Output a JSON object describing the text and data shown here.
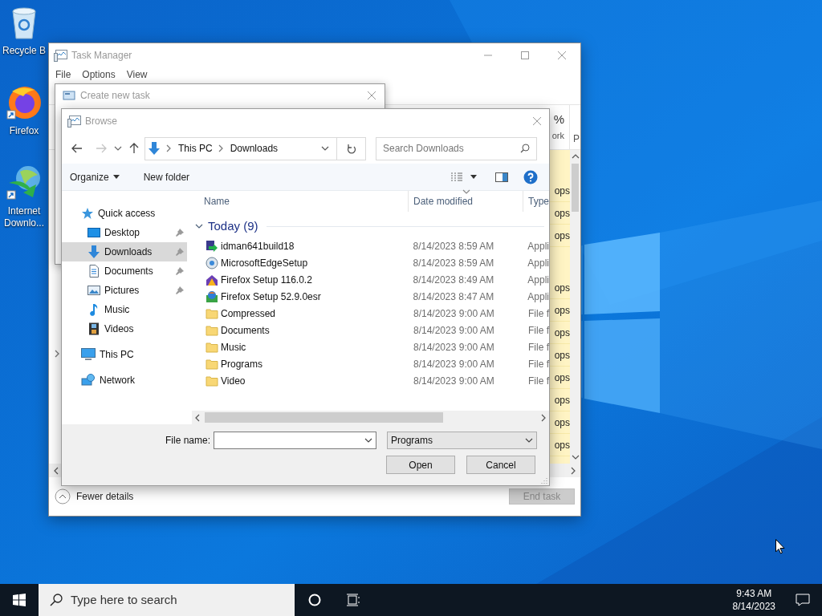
{
  "desktop_icons": [
    {
      "kind": "recycle",
      "label": "Recycle B"
    },
    {
      "kind": "firefox",
      "label": "Firefox"
    },
    {
      "kind": "idm",
      "label": "Internet Downlo..."
    }
  ],
  "task_manager": {
    "title": "Task Manager",
    "menu": [
      "File",
      "Options",
      "View"
    ],
    "column_header_top": "%",
    "column_header": "ork",
    "next_column_header": "P",
    "rows": [
      {
        "kind": "group"
      },
      {
        "kind": "process",
        "text": "ops"
      },
      {
        "kind": "process",
        "text": "ops"
      },
      {
        "kind": "process",
        "text": "ops"
      },
      {
        "kind": "group"
      },
      {
        "kind": "process",
        "text": "ops"
      },
      {
        "kind": "process",
        "text": "ops"
      },
      {
        "kind": "process",
        "text": "ops"
      },
      {
        "kind": "process",
        "text": "ops"
      },
      {
        "kind": "process",
        "text": "ops"
      },
      {
        "kind": "process",
        "text": "ops"
      },
      {
        "kind": "process",
        "text": "ops"
      },
      {
        "kind": "process",
        "text": "ops"
      }
    ],
    "fewer_details": "Fewer details",
    "end_task": {
      "label": "End task",
      "disabled": true
    }
  },
  "create_task": {
    "title": "Create new task"
  },
  "browse": {
    "title": "Browse",
    "path": [
      "This PC",
      "Downloads"
    ],
    "search_placeholder": "Search Downloads",
    "organize": "Organize",
    "new_folder": "New folder",
    "nav": [
      {
        "kind": "quick-access",
        "label": "Quick access",
        "selected": false,
        "children": [
          {
            "kind": "desktop",
            "label": "Desktop",
            "pinned": true,
            "selected": false
          },
          {
            "kind": "downloads",
            "label": "Downloads",
            "pinned": true,
            "selected": true
          },
          {
            "kind": "documents",
            "label": "Documents",
            "pinned": true,
            "selected": false
          },
          {
            "kind": "pictures",
            "label": "Pictures",
            "pinned": true,
            "selected": false
          },
          {
            "kind": "music",
            "label": "Music",
            "pinned": false,
            "selected": false
          },
          {
            "kind": "videos",
            "label": "Videos",
            "pinned": false,
            "selected": false
          }
        ]
      },
      {
        "kind": "this-pc",
        "label": "This PC",
        "selected": false
      },
      {
        "kind": "network",
        "label": "Network",
        "selected": false
      }
    ],
    "columns": [
      "Name",
      "Date modified",
      "Type"
    ],
    "group": {
      "label": "Today (9)",
      "expanded": true
    },
    "files": [
      {
        "kind": "idm",
        "name": "idman641build18",
        "date": "8/14/2023 8:59 AM",
        "type": "Appli"
      },
      {
        "kind": "edge",
        "name": "MicrosoftEdgeSetup",
        "date": "8/14/2023 8:59 AM",
        "type": "Appli"
      },
      {
        "kind": "firefox-new",
        "name": "Firefox Setup 116.0.2",
        "date": "8/14/2023 8:49 AM",
        "type": "Appli"
      },
      {
        "kind": "firefox-old",
        "name": "Firefox Setup 52.9.0esr",
        "date": "8/14/2023 8:47 AM",
        "type": "Appli"
      },
      {
        "kind": "folder",
        "name": "Compressed",
        "date": "8/14/2023 9:00 AM",
        "type": "File f"
      },
      {
        "kind": "folder",
        "name": "Documents",
        "date": "8/14/2023 9:00 AM",
        "type": "File f"
      },
      {
        "kind": "folder",
        "name": "Music",
        "date": "8/14/2023 9:00 AM",
        "type": "File f"
      },
      {
        "kind": "folder",
        "name": "Programs",
        "date": "8/14/2023 9:00 AM",
        "type": "File f"
      },
      {
        "kind": "folder",
        "name": "Video",
        "date": "8/14/2023 9:00 AM",
        "type": "File f"
      }
    ],
    "file_name_label": "File name:",
    "file_type": "Programs",
    "open": "Open",
    "cancel": "Cancel"
  },
  "taskbar": {
    "search_placeholder": "Type here to search",
    "time": "9:43 AM",
    "date": "8/14/2023"
  }
}
